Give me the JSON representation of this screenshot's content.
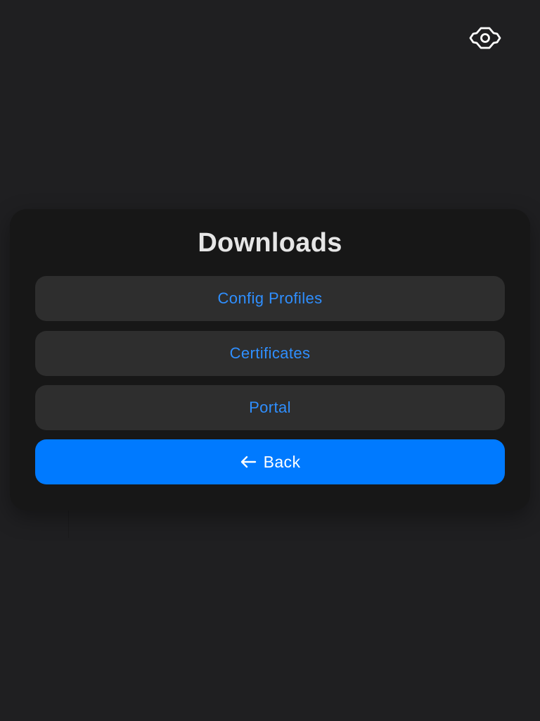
{
  "header": {
    "settings_icon": "gear-icon"
  },
  "dialog": {
    "title": "Downloads",
    "items": [
      {
        "label": "Config Profiles"
      },
      {
        "label": "Certificates"
      },
      {
        "label": "Portal"
      }
    ],
    "back": {
      "label": "Back",
      "icon": "arrow-left-icon"
    }
  },
  "colors": {
    "background": "#1f1f21",
    "card": "#171717",
    "item_bg": "#2e2e2e",
    "link_blue": "#2f8fff",
    "primary_blue": "#007aff",
    "title": "#e6e6e6"
  }
}
